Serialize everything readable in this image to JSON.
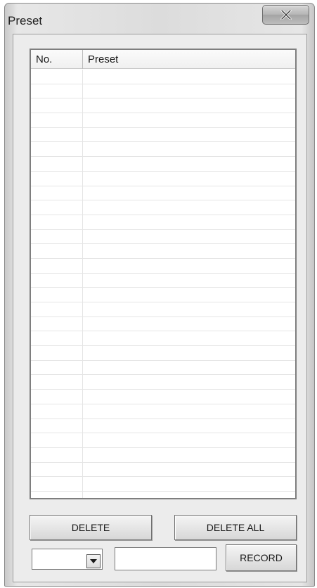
{
  "window": {
    "title": "Preset",
    "close_icon": "close-x-icon"
  },
  "list": {
    "columns": {
      "no": "No.",
      "preset": "Preset"
    },
    "rows": [
      {
        "no": "",
        "preset": ""
      },
      {
        "no": "",
        "preset": ""
      },
      {
        "no": "",
        "preset": ""
      },
      {
        "no": "",
        "preset": ""
      },
      {
        "no": "",
        "preset": ""
      },
      {
        "no": "",
        "preset": ""
      },
      {
        "no": "",
        "preset": ""
      },
      {
        "no": "",
        "preset": ""
      },
      {
        "no": "",
        "preset": ""
      },
      {
        "no": "",
        "preset": ""
      },
      {
        "no": "",
        "preset": ""
      },
      {
        "no": "",
        "preset": ""
      },
      {
        "no": "",
        "preset": ""
      },
      {
        "no": "",
        "preset": ""
      },
      {
        "no": "",
        "preset": ""
      },
      {
        "no": "",
        "preset": ""
      },
      {
        "no": "",
        "preset": ""
      },
      {
        "no": "",
        "preset": ""
      },
      {
        "no": "",
        "preset": ""
      },
      {
        "no": "",
        "preset": ""
      },
      {
        "no": "",
        "preset": ""
      },
      {
        "no": "",
        "preset": ""
      },
      {
        "no": "",
        "preset": ""
      },
      {
        "no": "",
        "preset": ""
      },
      {
        "no": "",
        "preset": ""
      },
      {
        "no": "",
        "preset": ""
      },
      {
        "no": "",
        "preset": ""
      },
      {
        "no": "",
        "preset": ""
      },
      {
        "no": "",
        "preset": ""
      },
      {
        "no": "",
        "preset": ""
      }
    ]
  },
  "buttons": {
    "delete": "DELETE",
    "delete_all": "DELETE ALL",
    "record": "RECORD"
  },
  "combo": {
    "value": "",
    "arrow_icon": "chevron-down-icon"
  },
  "name_field": {
    "value": "",
    "placeholder": ""
  }
}
